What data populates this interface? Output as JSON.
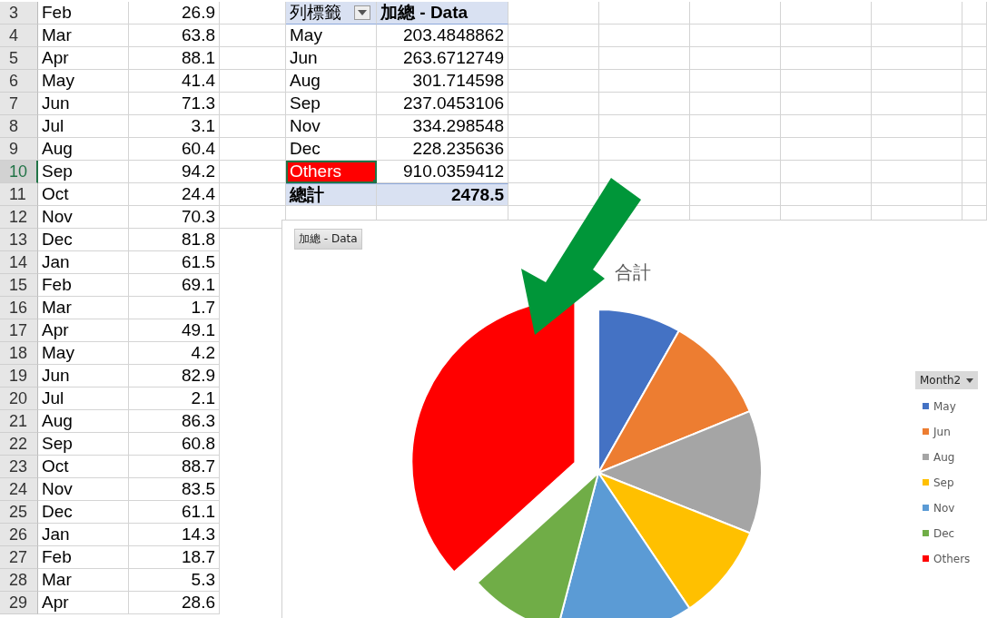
{
  "sheet": {
    "rows": [
      {
        "number": "3",
        "month": "Feb",
        "value": "26.9",
        "selected": false
      },
      {
        "number": "4",
        "month": "Mar",
        "value": "63.8",
        "selected": false
      },
      {
        "number": "5",
        "month": "Apr",
        "value": "88.1",
        "selected": false
      },
      {
        "number": "6",
        "month": "May",
        "value": "41.4",
        "selected": false
      },
      {
        "number": "7",
        "month": "Jun",
        "value": "71.3",
        "selected": false
      },
      {
        "number": "8",
        "month": "Jul",
        "value": "3.1",
        "selected": false
      },
      {
        "number": "9",
        "month": "Aug",
        "value": "60.4",
        "selected": false
      },
      {
        "number": "10",
        "month": "Sep",
        "value": "94.2",
        "selected": true
      },
      {
        "number": "11",
        "month": "Oct",
        "value": "24.4",
        "selected": false
      },
      {
        "number": "12",
        "month": "Nov",
        "value": "70.3",
        "selected": false
      },
      {
        "number": "13",
        "month": "Dec",
        "value": "81.8",
        "selected": false
      },
      {
        "number": "14",
        "month": "Jan",
        "value": "61.5",
        "selected": false
      },
      {
        "number": "15",
        "month": "Feb",
        "value": "69.1",
        "selected": false
      },
      {
        "number": "16",
        "month": "Mar",
        "value": "1.7",
        "selected": false
      },
      {
        "number": "17",
        "month": "Apr",
        "value": "49.1",
        "selected": false
      },
      {
        "number": "18",
        "month": "May",
        "value": "4.2",
        "selected": false
      },
      {
        "number": "19",
        "month": "Jun",
        "value": "82.9",
        "selected": false
      },
      {
        "number": "20",
        "month": "Jul",
        "value": "2.1",
        "selected": false
      },
      {
        "number": "21",
        "month": "Aug",
        "value": "86.3",
        "selected": false
      },
      {
        "number": "22",
        "month": "Sep",
        "value": "60.8",
        "selected": false
      },
      {
        "number": "23",
        "month": "Oct",
        "value": "88.7",
        "selected": false
      },
      {
        "number": "24",
        "month": "Nov",
        "value": "83.5",
        "selected": false
      },
      {
        "number": "25",
        "month": "Dec",
        "value": "61.1",
        "selected": false
      },
      {
        "number": "26",
        "month": "Jan",
        "value": "14.3",
        "selected": false
      },
      {
        "number": "27",
        "month": "Feb",
        "value": "18.7",
        "selected": false
      },
      {
        "number": "28",
        "month": "Mar",
        "value": "5.3",
        "selected": false
      },
      {
        "number": "29",
        "month": "Apr",
        "value": "28.6",
        "selected": false
      }
    ]
  },
  "pivot": {
    "row_label_header": "列標籤",
    "value_header": "加總 - Data",
    "rows": [
      {
        "label": "May",
        "value": "203.4848862",
        "highlighted": false,
        "selected": false
      },
      {
        "label": "Jun",
        "value": "263.6712749",
        "highlighted": false,
        "selected": false
      },
      {
        "label": "Aug",
        "value": "301.714598",
        "highlighted": false,
        "selected": false
      },
      {
        "label": "Sep",
        "value": "237.0453106",
        "highlighted": false,
        "selected": false
      },
      {
        "label": "Nov",
        "value": "334.298548",
        "highlighted": false,
        "selected": false
      },
      {
        "label": "Dec",
        "value": "228.235636",
        "highlighted": false,
        "selected": false
      },
      {
        "label": "Others",
        "value": "910.0359412",
        "highlighted": true,
        "selected": true
      }
    ],
    "total": {
      "label": "總計",
      "value": "2478.5"
    }
  },
  "chart": {
    "field_button": "加總 - Data",
    "legend": {
      "field_button": "Month2",
      "items": [
        {
          "color": "#4472c4",
          "exploded": false
        },
        {
          "color": "#ed7d31",
          "exploded": false
        },
        {
          "color": "#a5a5a5",
          "exploded": false
        },
        {
          "color": "#ffc000",
          "exploded": false
        },
        {
          "color": "#5b9bd5",
          "exploded": false
        },
        {
          "color": "#70ad47",
          "exploded": false
        },
        {
          "color": "#ff0000",
          "exploded": true
        }
      ]
    },
    "chart_data": {
      "type": "pie",
      "title": "合計",
      "categories": [
        "May",
        "Jun",
        "Aug",
        "Sep",
        "Nov",
        "Dec",
        "Others"
      ],
      "values": [
        8.21,
        10.64,
        12.17,
        9.56,
        13.49,
        9.21,
        36.72
      ]
    }
  }
}
